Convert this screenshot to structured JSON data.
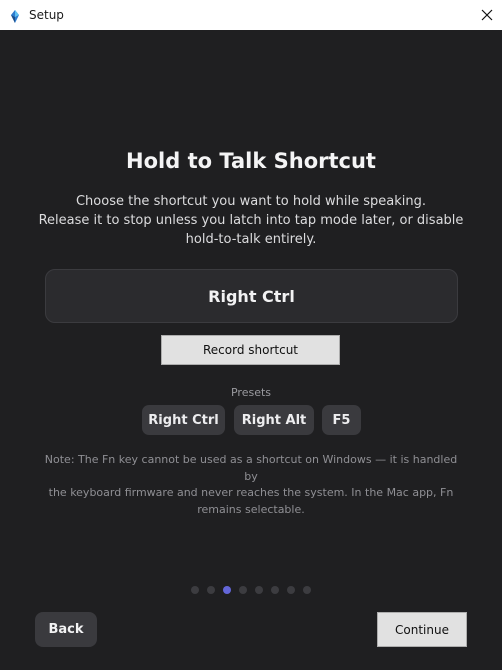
{
  "window": {
    "title": "Setup",
    "app_icon": "app-logo-icon",
    "close_icon": "close-icon"
  },
  "main": {
    "heading": "Hold to Talk Shortcut",
    "description_lines": [
      "Choose the shortcut you want to hold while speaking.",
      "Release it to stop unless you latch into tap mode later, or disable",
      "hold-to-talk entirely."
    ],
    "current_shortcut": "Right Ctrl",
    "record_button": "Record shortcut",
    "presets_label": "Presets",
    "presets": [
      "Right Ctrl",
      "Right Alt",
      "F5"
    ],
    "note_lines": [
      "Note: The Fn key cannot be used as a shortcut on Windows — it is handled by",
      "the keyboard firmware and never reaches the system. In the Mac app, Fn",
      "remains selectable."
    ]
  },
  "wizard": {
    "total_steps": 8,
    "current_step": 3
  },
  "footer": {
    "back_label": "Back",
    "continue_label": "Continue"
  },
  "colors": {
    "background": "#1f1f21",
    "accent": "#6366d8"
  }
}
